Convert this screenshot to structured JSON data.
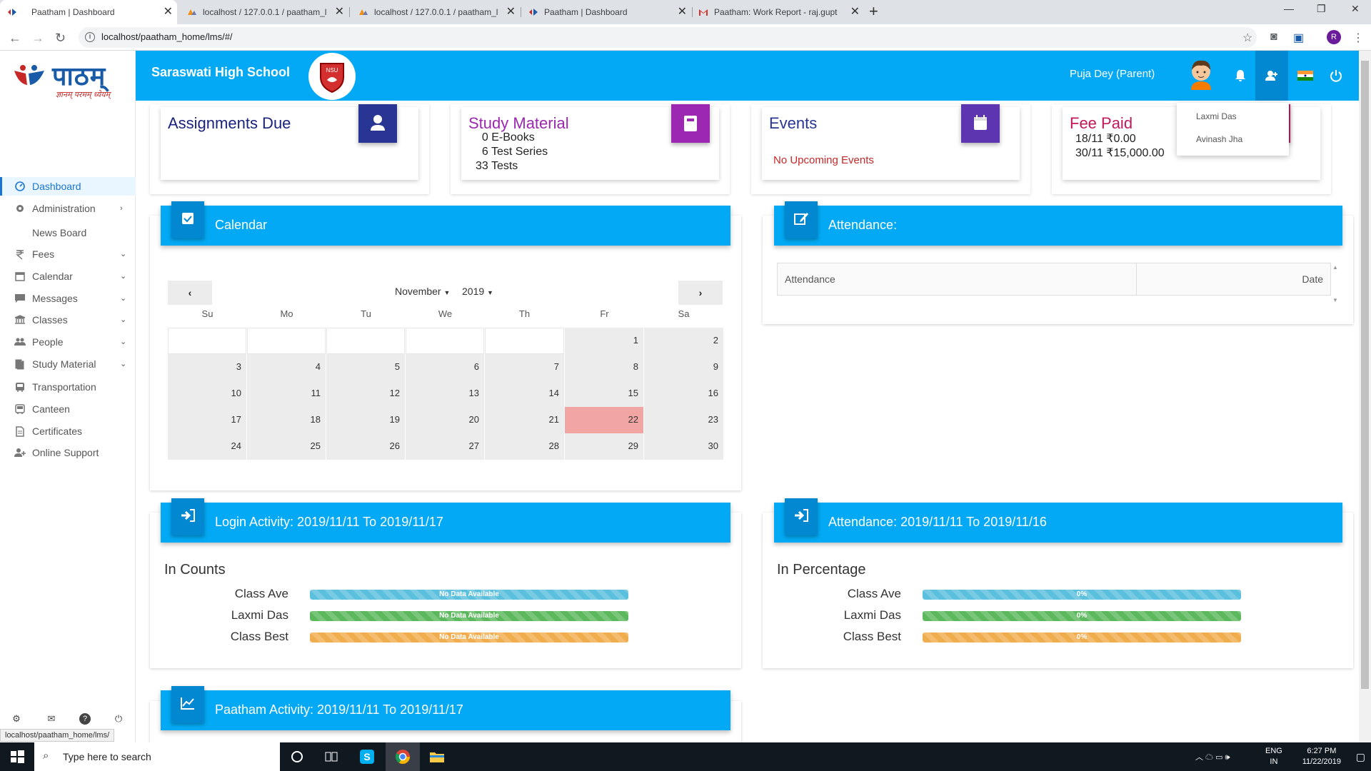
{
  "browser": {
    "tabs": [
      {
        "title": "Paatham | Dashboard",
        "active": true,
        "favicon": "paatham-icon"
      },
      {
        "title": "localhost / 127.0.0.1 / paatham_l",
        "active": false,
        "favicon": "phpmyadmin-icon"
      },
      {
        "title": "localhost / 127.0.0.1 / paatham_l",
        "active": false,
        "favicon": "phpmyadmin-icon"
      },
      {
        "title": "Paatham | Dashboard",
        "active": false,
        "favicon": "paatham-icon"
      },
      {
        "title": "Paatham: Work Report - raj.gupt",
        "active": false,
        "favicon": "gmail-icon"
      }
    ],
    "url": "localhost/paatham_home/lms/#/",
    "profile_initial": "R",
    "status_url": "localhost/paatham_home/lms/"
  },
  "app": {
    "logo_text": "पाठम्",
    "logo_tagline": "ज्ञानम् परमम् ध्येयम्",
    "school_name": "Saraswati High School",
    "user_label": "Puja Dey (Parent)",
    "brand_color": "#03a9f4"
  },
  "sidebar": {
    "items": [
      {
        "label": "Dashboard",
        "icon": "dashboard-icon",
        "active": true,
        "chevron": ""
      },
      {
        "label": "Administration",
        "icon": "gear-icon",
        "chevron": "›"
      },
      {
        "label": "News Board",
        "icon": "",
        "chevron": ""
      },
      {
        "label": "Fees",
        "icon": "rupee-icon",
        "chevron": "⌄"
      },
      {
        "label": "Calendar",
        "icon": "calendar-icon",
        "chevron": "⌄"
      },
      {
        "label": "Messages",
        "icon": "message-icon",
        "chevron": "⌄"
      },
      {
        "label": "Classes",
        "icon": "institution-icon",
        "chevron": "⌄"
      },
      {
        "label": "People",
        "icon": "people-icon",
        "chevron": "⌄"
      },
      {
        "label": "Study Material",
        "icon": "book-icon",
        "chevron": "⌄"
      },
      {
        "label": "Transportation",
        "icon": "bus-icon",
        "chevron": ""
      },
      {
        "label": "Canteen",
        "icon": "canteen-icon",
        "chevron": ""
      },
      {
        "label": "Certificates",
        "icon": "certificate-icon",
        "chevron": ""
      },
      {
        "label": "Online Support",
        "icon": "support-icon",
        "chevron": ""
      }
    ]
  },
  "dropdown": {
    "items": [
      "Laxmi Das",
      "Avinash Jha"
    ]
  },
  "cards": {
    "assignments": {
      "title": "Assignments Due",
      "color": "#283593"
    },
    "study": {
      "title": "Study Material",
      "lines": [
        "  0 E-Books",
        "  6 Test Series",
        "33 Tests"
      ],
      "color": "#9c27b0"
    },
    "events": {
      "title": "Events",
      "message": "No Upcoming Events",
      "color": "#5e35b1"
    },
    "fees": {
      "title": "Fee Paid",
      "lines": [
        "18/11 ₹0.00",
        "30/11 ₹15,000.00"
      ],
      "color": "#c2185b"
    }
  },
  "calendar": {
    "title": "Calendar",
    "month": "November",
    "year": "2019",
    "prev": "‹",
    "next": "›",
    "weekdays": [
      "Su",
      "Mo",
      "Tu",
      "We",
      "Th",
      "Fr",
      "Sa"
    ],
    "first_weekday": 5,
    "days_in_month": 30,
    "today": 22
  },
  "attendance_panel": {
    "title": "Attendance:",
    "col_attendance": "Attendance",
    "col_date": "Date"
  },
  "login_activity": {
    "title": "Login Activity: 2019/11/11 To 2019/11/17",
    "subtitle": "In Counts",
    "rows": [
      {
        "label": "Class Ave",
        "text": "No Data Available",
        "color": "blue"
      },
      {
        "label": "Laxmi Das",
        "text": "No Data Available",
        "color": "green"
      },
      {
        "label": "Class Best",
        "text": "No Data Available",
        "color": "orange"
      }
    ]
  },
  "attendance_activity": {
    "title": "Attendance: 2019/11/11 To 2019/11/16",
    "subtitle": "In Percentage",
    "rows": [
      {
        "label": "Class Ave",
        "text": "0%",
        "color": "blue"
      },
      {
        "label": "Laxmi Das",
        "text": "0%",
        "color": "green"
      },
      {
        "label": "Class Best",
        "text": "0%",
        "color": "orange"
      }
    ]
  },
  "paatham_activity": {
    "title": "Paatham Activity: 2019/11/11 To 2019/11/17"
  },
  "taskbar": {
    "search_placeholder": "Type here to search",
    "lang1": "ENG",
    "lang2": "IN",
    "time": "6:27 PM",
    "date": "11/22/2019"
  }
}
